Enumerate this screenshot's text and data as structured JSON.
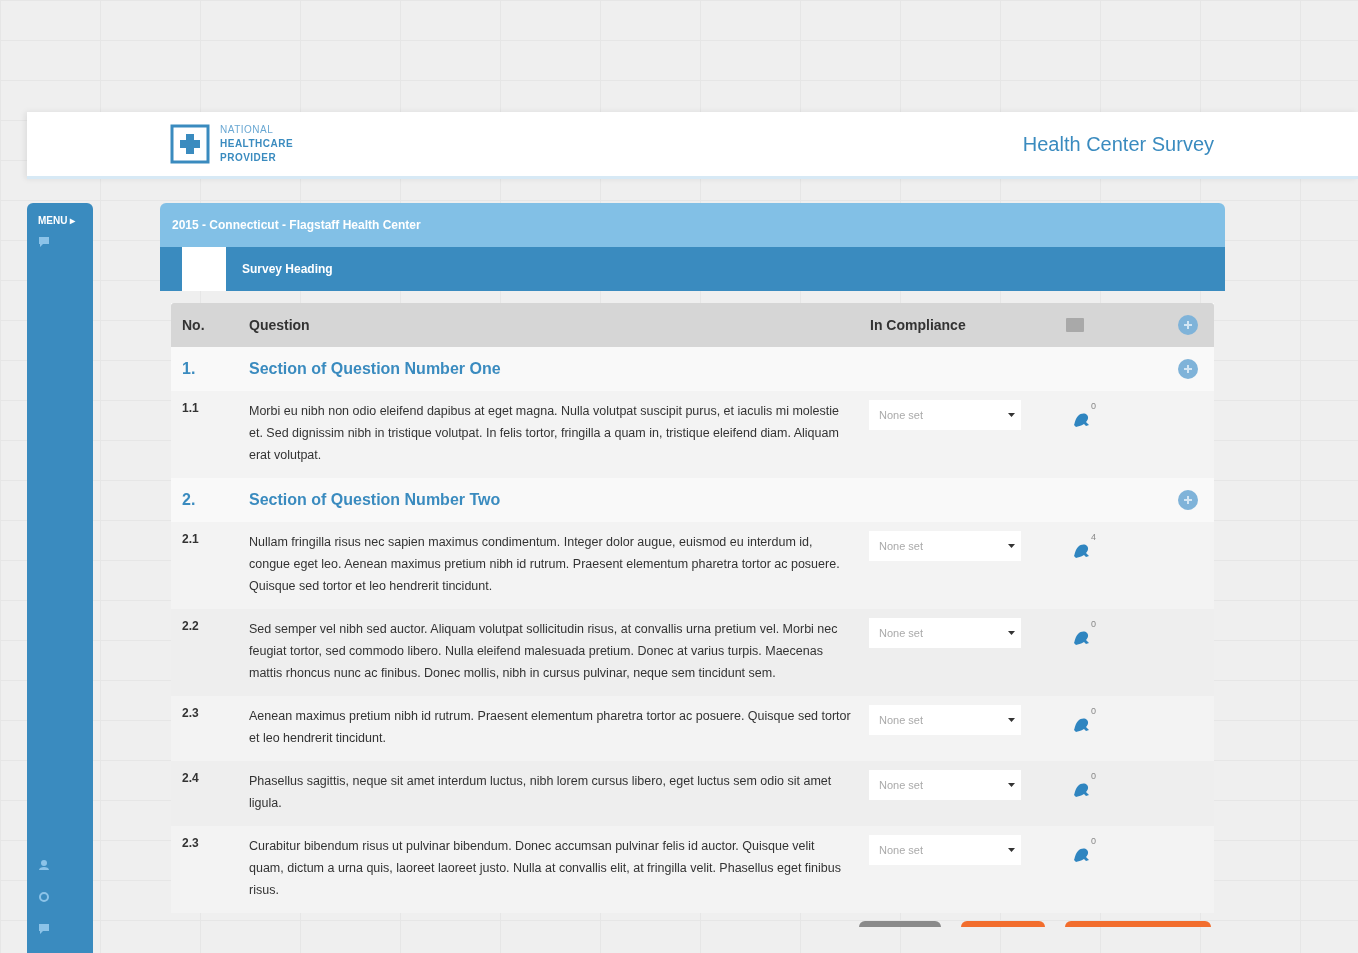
{
  "header": {
    "logo_lines": [
      "NATIONAL",
      "HEALTHCARE",
      "PROVIDER"
    ],
    "title": "Health Center Survey"
  },
  "sidebar": {
    "menu_label": "MENU ▸"
  },
  "panel": {
    "title": "2015 - Connecticut - Flagstaff Health Center",
    "tabs": [
      {
        "selected": true
      },
      {
        "label": "Survey Heading",
        "selected": false
      }
    ],
    "table": {
      "columns": [
        "No.",
        "Question",
        "In Compliance"
      ],
      "rows": [
        {
          "kind": "section",
          "number": "1.",
          "title": "Section of Question Number One"
        },
        {
          "kind": "question",
          "number": "1.1",
          "text": "Morbi eu nibh non odio eleifend dapibus at eget magna. Nulla volutpat suscipit purus, et iaculis mi molestie et. Sed dignissim nibh in tristique volutpat. In felis tortor, fringilla a quam in, tristique eleifend diam. Aliquam erat volutpat.",
          "compliance": "None set",
          "count": "0"
        },
        {
          "kind": "section",
          "number": "2.",
          "title": "Section of Question Number Two"
        },
        {
          "kind": "question",
          "number": "2.1",
          "text": "Nullam fringilla risus nec sapien maximus condimentum. Integer dolor augue, euismod eu interdum id, congue eget leo. Aenean maximus pretium nibh id rutrum. Praesent elementum pharetra tortor ac posuere. Quisque sed tortor et leo hendrerit tincidunt.",
          "compliance": "None set",
          "count": "4"
        },
        {
          "kind": "question",
          "number": "2.2",
          "text": "Sed semper vel nibh sed auctor. Aliquam volutpat sollicitudin risus, at convallis urna pretium vel. Morbi nec feugiat tortor, sed commodo libero. Nulla eleifend malesuada pretium. Donec at varius turpis. Maecenas mattis rhoncus nunc ac finibus. Donec mollis, nibh in cursus pulvinar, neque sem tincidunt sem.",
          "compliance": "None set",
          "count": "0"
        },
        {
          "kind": "question",
          "number": "2.3",
          "text": "Aenean maximus pretium nibh id rutrum. Praesent elementum pharetra tortor ac posuere. Quisque sed tortor et leo hendrerit tincidunt.",
          "compliance": "None set",
          "count": "0"
        },
        {
          "kind": "question",
          "number": "2.4",
          "text": "Phasellus sagittis, neque sit amet interdum luctus, nibh lorem cursus libero, eget luctus sem odio sit amet ligula.",
          "compliance": "None set",
          "count": "0"
        },
        {
          "kind": "question",
          "number": "2.3",
          "text": "Curabitur bibendum risus ut pulvinar bibendum. Donec accumsan pulvinar felis id auctor. Quisque velit quam, dictum a urna quis, laoreet laoreet justo. Nulla at convallis elit, at fringilla velit. Phasellus eget finibus risus.",
          "compliance": "None set",
          "count": "0"
        }
      ]
    },
    "footer_buttons": [
      {
        "kind": "secondary"
      },
      {
        "kind": "primary"
      },
      {
        "kind": "primary"
      }
    ]
  }
}
